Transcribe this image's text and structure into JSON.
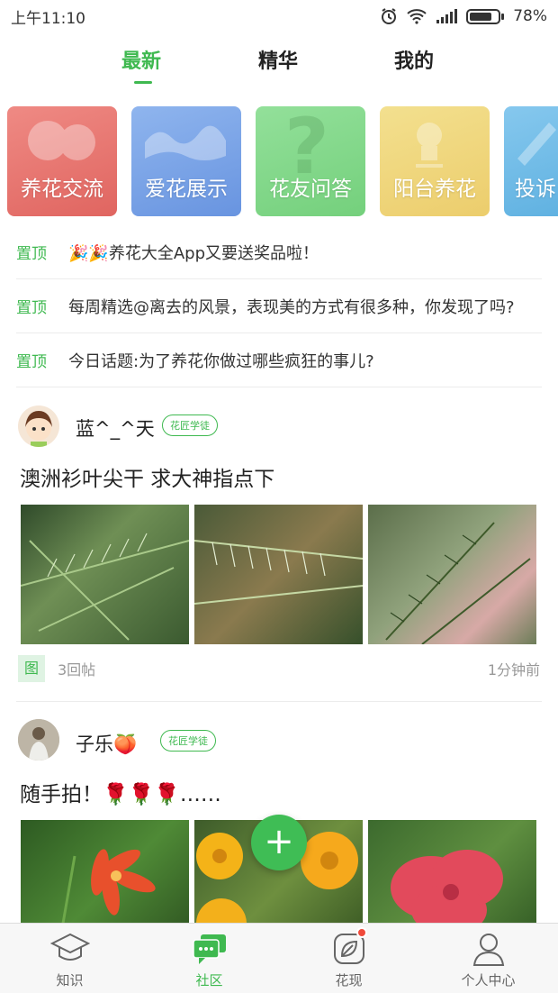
{
  "status_bar": {
    "time": "上午11:10",
    "battery": "78%"
  },
  "tabs": [
    {
      "label": "最新",
      "active": true
    },
    {
      "label": "精华",
      "active": false
    },
    {
      "label": "我的",
      "active": false
    }
  ],
  "categories": [
    {
      "label": "养花交流",
      "color": "#e8706a"
    },
    {
      "label": "爱花展示",
      "color": "#7aa6e6"
    },
    {
      "label": "花友问答",
      "color": "#83d88a"
    },
    {
      "label": "阳台养花",
      "color": "#f0d77c"
    },
    {
      "label": "投诉",
      "color": "#68b6e6"
    }
  ],
  "pinned": [
    {
      "tag": "置顶",
      "text": "🎉🎉养花大全App又要送奖品啦！"
    },
    {
      "tag": "置顶",
      "text": "每周精选@离去的风景，表现美的方式有很多种，你发现了吗?"
    },
    {
      "tag": "置顶",
      "text": "今日话题:为了养花你做过哪些疯狂的事儿?"
    }
  ],
  "posts": [
    {
      "username": "蓝^_^天",
      "badge": "花匠学徒",
      "title": "澳洲衫叶尖干 求大神指点下",
      "image_tag": "图",
      "replies": "3回帖",
      "time": "1分钟前"
    },
    {
      "username": "子乐🍑",
      "badge": "花匠学徒",
      "title": "随手拍！🌹🌹🌹……"
    }
  ],
  "fab": {
    "symbol": "+"
  },
  "bottom_nav": [
    {
      "label": "知识",
      "icon": "graduation-cap-icon",
      "active": false
    },
    {
      "label": "社区",
      "icon": "chat-bubbles-icon",
      "active": true
    },
    {
      "label": "花现",
      "icon": "leaf-icon",
      "active": false
    },
    {
      "label": "个人中心",
      "icon": "person-icon",
      "active": false
    }
  ],
  "colors": {
    "accent": "#3fb950",
    "notification": "#f04a3b"
  }
}
